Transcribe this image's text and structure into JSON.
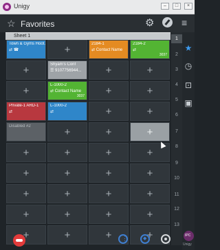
{
  "window": {
    "app_title": "Unigy"
  },
  "header": {
    "title": "Favorites"
  },
  "sheet": {
    "label": "Sheet 1"
  },
  "tiles": {
    "t_town": {
      "line1": "Town & Gyms Hoot...",
      "line2": "⇄ ☎"
    },
    "t_2184_1": {
      "line1": "2184-1",
      "line2": "⇄ Contact Name"
    },
    "t_2184_2": {
      "line1": "2184-2",
      "line2": "⇄",
      "line3": "3037"
    },
    "t_shyam": {
      "line1": "Shyam's Conf",
      "line2": "☰ 9107756944..."
    },
    "t_l1000_2a": {
      "line1": "L-1000-2",
      "line2": "⇄ Contact Name",
      "line3": "3037"
    },
    "t_private": {
      "line1": "Private-1 ARD-1",
      "line2": "⇄"
    },
    "t_l1000_2b": {
      "line1": "L-1000-2",
      "line2": "⇄"
    },
    "t_disabled": {
      "line1": "Disabled #2"
    }
  },
  "plus": "+",
  "row_numbers": [
    "1",
    "2",
    "3",
    "4",
    "5",
    "6",
    "7",
    "8",
    "9",
    "10",
    "11",
    "12",
    "13"
  ],
  "avatar": {
    "label": "IPC",
    "sub": "Unigy"
  },
  "colors": {
    "accent": "#3d9bf0",
    "hangup": "#e23b3b",
    "blue": "#2f86c9",
    "orange": "#e48b22",
    "green": "#53b433",
    "red": "#b8383f"
  }
}
